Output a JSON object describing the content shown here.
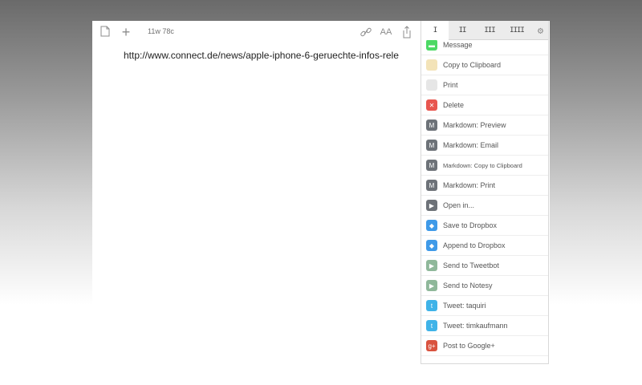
{
  "toolbar": {
    "word_count": "11w 78c"
  },
  "document": {
    "text": "http://www.connect.de/news/apple-iphone-6-geruechte-infos-rele"
  },
  "panel": {
    "tabs": [
      "I",
      "II",
      "III",
      "IIII"
    ],
    "items": [
      {
        "label": "Message",
        "icon": "message-icon",
        "color": "#4cd964",
        "glyph": "▬"
      },
      {
        "label": "Copy to Clipboard",
        "icon": "clipboard-icon",
        "color": "#f3e3b8",
        "glyph": ""
      },
      {
        "label": "Print",
        "icon": "printer-icon",
        "color": "#e6e6e6",
        "glyph": ""
      },
      {
        "label": "Delete",
        "icon": "delete-icon",
        "color": "#e8564f",
        "glyph": "✕"
      },
      {
        "label": "Markdown: Preview",
        "icon": "markdown-preview-icon",
        "color": "#6d7278",
        "glyph": "M"
      },
      {
        "label": "Markdown: Email",
        "icon": "markdown-email-icon",
        "color": "#6d7278",
        "glyph": "M"
      },
      {
        "label": "Markdown: Copy to Clipboard",
        "icon": "markdown-clipboard-icon",
        "color": "#6d7278",
        "glyph": "M"
      },
      {
        "label": "Markdown: Print",
        "icon": "markdown-print-icon",
        "color": "#6d7278",
        "glyph": "M"
      },
      {
        "label": "Open in...",
        "icon": "open-in-icon",
        "color": "#6d7278",
        "glyph": "▶"
      },
      {
        "label": "Save to Dropbox",
        "icon": "dropbox-icon",
        "color": "#3f9ae8",
        "glyph": "◆"
      },
      {
        "label": "Append to Dropbox",
        "icon": "dropbox-icon",
        "color": "#3f9ae8",
        "glyph": "◆"
      },
      {
        "label": "Send to Tweetbot",
        "icon": "tweetbot-icon",
        "color": "#8fb89a",
        "glyph": "▶"
      },
      {
        "label": "Send to Notesy",
        "icon": "notesy-icon",
        "color": "#8fb89a",
        "glyph": "▶"
      },
      {
        "label": "Tweet: taquiri",
        "icon": "twitter-icon",
        "color": "#3fb3e8",
        "glyph": "t"
      },
      {
        "label": "Tweet: timkaufmann",
        "icon": "twitter-icon",
        "color": "#3fb3e8",
        "glyph": "t"
      },
      {
        "label": "Post to Google+",
        "icon": "google-plus-icon",
        "color": "#d9533f",
        "glyph": "g+"
      }
    ]
  }
}
